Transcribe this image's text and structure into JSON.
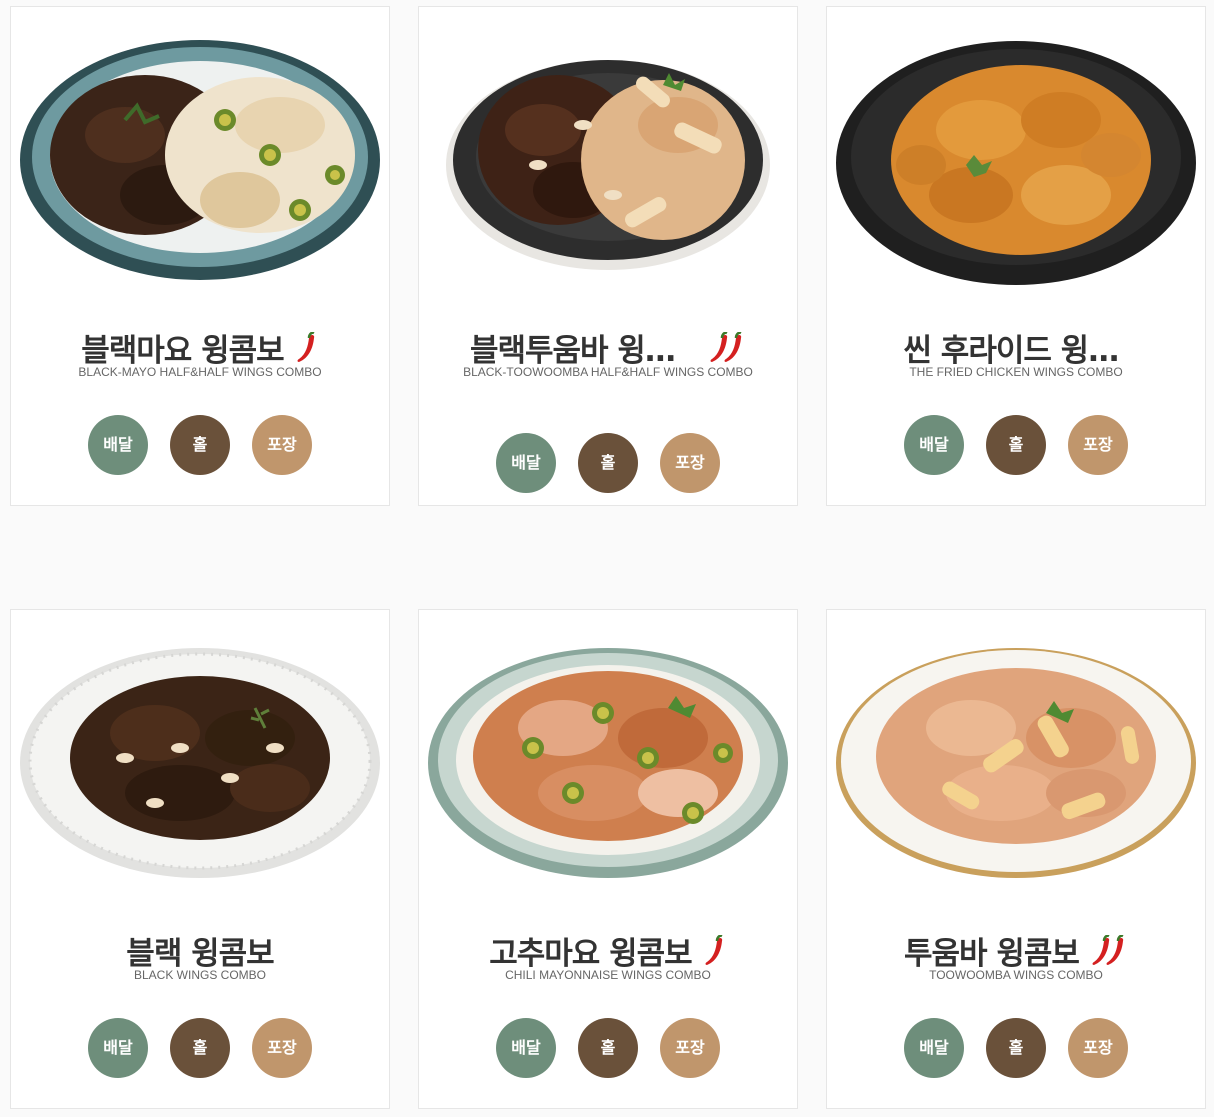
{
  "buttons": {
    "delivery": "배달",
    "hall": "홀",
    "takeout": "포장"
  },
  "colors": {
    "delivery": "#6e8e7b",
    "hall": "#6a513a",
    "takeout": "#c0966c",
    "title": "#333333",
    "subtitle": "#666666"
  },
  "menu": [
    {
      "name": "블랙마요 윙콤보",
      "subtitle": "BLACK-MAYO HALF&HALF WINGS COMBO",
      "spicy_level": 1,
      "image": "black-mayo-wings-photo"
    },
    {
      "name": "블랙투움바 윙콤보",
      "subtitle": "BLACK-TOOWOOMBA HALF&HALF WINGS COMBO",
      "spicy_level": 2,
      "image": "black-toowoomba-wings-photo"
    },
    {
      "name": "씬 후라이드 윙콤보",
      "subtitle": "THE FRIED CHICKEN WINGS COMBO",
      "spicy_level": 0,
      "image": "fried-wings-photo"
    },
    {
      "name": "블랙 윙콤보",
      "subtitle": "BLACK WINGS COMBO",
      "spicy_level": 0,
      "image": "black-wings-photo"
    },
    {
      "name": "고추마요 윙콤보",
      "subtitle": "CHILI MAYONNAISE WINGS COMBO",
      "spicy_level": 1,
      "image": "chili-mayo-wings-photo"
    },
    {
      "name": "투움바 윙콤보",
      "subtitle": "TOOWOOMBA WINGS COMBO",
      "spicy_level": 2,
      "image": "toowoomba-wings-photo"
    }
  ]
}
